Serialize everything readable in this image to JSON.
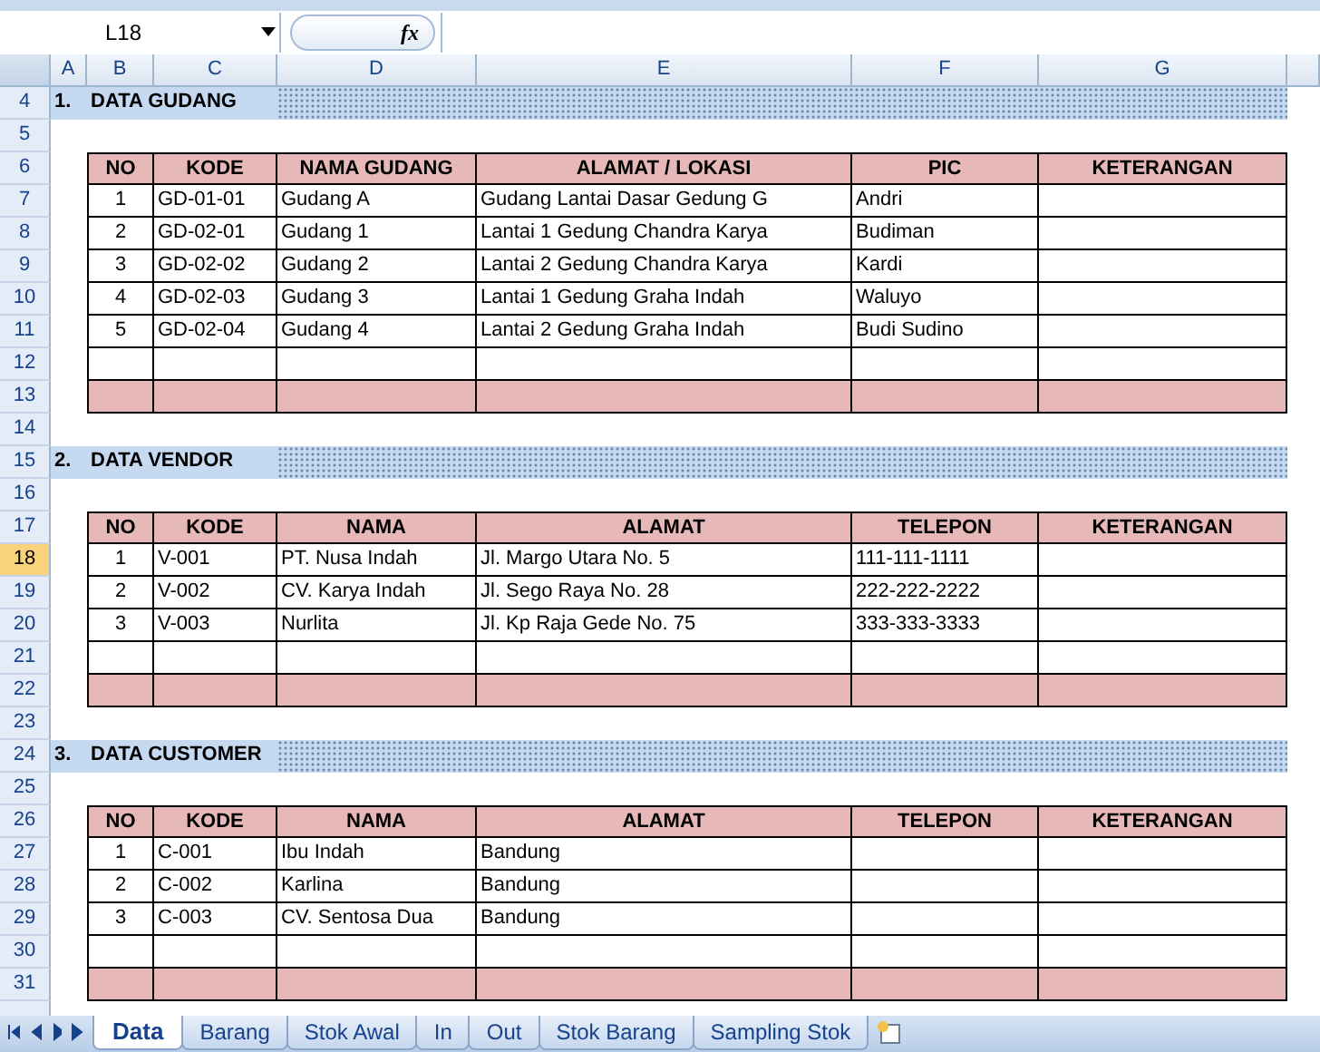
{
  "formula_bar": {
    "name_box": "L18",
    "function_label": "fx"
  },
  "column_headers": [
    "A",
    "B",
    "C",
    "D",
    "E",
    "F",
    "G"
  ],
  "row_headers": [
    {
      "label": "4",
      "selected": false
    },
    {
      "label": "5",
      "selected": false
    },
    {
      "label": "6",
      "selected": false
    },
    {
      "label": "7",
      "selected": false
    },
    {
      "label": "8",
      "selected": false
    },
    {
      "label": "9",
      "selected": false
    },
    {
      "label": "10",
      "selected": false
    },
    {
      "label": "11",
      "selected": false
    },
    {
      "label": "12",
      "selected": false
    },
    {
      "label": "13",
      "selected": false
    },
    {
      "label": "14",
      "selected": false
    },
    {
      "label": "15",
      "selected": false
    },
    {
      "label": "16",
      "selected": false
    },
    {
      "label": "17",
      "selected": false
    },
    {
      "label": "18",
      "selected": true
    },
    {
      "label": "19",
      "selected": false
    },
    {
      "label": "20",
      "selected": false
    },
    {
      "label": "21",
      "selected": false
    },
    {
      "label": "22",
      "selected": false
    },
    {
      "label": "23",
      "selected": false
    },
    {
      "label": "24",
      "selected": false
    },
    {
      "label": "25",
      "selected": false
    },
    {
      "label": "26",
      "selected": false
    },
    {
      "label": "27",
      "selected": false
    },
    {
      "label": "28",
      "selected": false
    },
    {
      "label": "29",
      "selected": false
    },
    {
      "label": "30",
      "selected": false
    },
    {
      "label": "31",
      "selected": false
    }
  ],
  "sections": [
    {
      "number": "1.",
      "title": "DATA GUDANG",
      "columns": [
        "NO",
        "KODE",
        "NAMA GUDANG",
        "ALAMAT / LOKASI",
        "PIC",
        "KETERANGAN"
      ],
      "rows": [
        {
          "kind": "data",
          "cells": [
            "1",
            "GD-01-01",
            "Gudang A",
            "Gudang Lantai Dasar Gedung G",
            "Andri",
            ""
          ]
        },
        {
          "kind": "data",
          "cells": [
            "2",
            "GD-02-01",
            "Gudang 1",
            "Lantai 1 Gedung Chandra Karya",
            "Budiman",
            ""
          ]
        },
        {
          "kind": "data",
          "cells": [
            "3",
            "GD-02-02",
            "Gudang 2",
            "Lantai 2 Gedung Chandra Karya",
            "Kardi",
            ""
          ]
        },
        {
          "kind": "data",
          "cells": [
            "4",
            "GD-02-03",
            "Gudang 3",
            "Lantai 1 Gedung Graha Indah",
            "Waluyo",
            ""
          ]
        },
        {
          "kind": "data",
          "cells": [
            "5",
            "GD-02-04",
            "Gudang 4",
            "Lantai 2 Gedung Graha Indah",
            "Budi Sudino",
            ""
          ]
        },
        {
          "kind": "blank"
        },
        {
          "kind": "footer"
        }
      ]
    },
    {
      "number": "2.",
      "title": "DATA VENDOR",
      "columns": [
        "NO",
        "KODE",
        "NAMA",
        "ALAMAT",
        "TELEPON",
        "KETERANGAN"
      ],
      "rows": [
        {
          "kind": "data",
          "cells": [
            "1",
            "V-001",
            "PT. Nusa Indah",
            "Jl. Margo Utara No. 5",
            "111-111-1111",
            ""
          ]
        },
        {
          "kind": "data",
          "cells": [
            "2",
            "V-002",
            "CV. Karya Indah",
            "Jl. Sego Raya No. 28",
            "222-222-2222",
            ""
          ]
        },
        {
          "kind": "data",
          "cells": [
            "3",
            "V-003",
            "Nurlita",
            "Jl. Kp Raja Gede No. 75",
            "333-333-3333",
            ""
          ]
        },
        {
          "kind": "blank"
        },
        {
          "kind": "footer"
        }
      ]
    },
    {
      "number": "3.",
      "title": "DATA CUSTOMER",
      "columns": [
        "NO",
        "KODE",
        "NAMA",
        "ALAMAT",
        "TELEPON",
        "KETERANGAN"
      ],
      "rows": [
        {
          "kind": "data",
          "cells": [
            "1",
            "C-001",
            "Ibu Indah",
            "Bandung",
            "",
            ""
          ]
        },
        {
          "kind": "data",
          "cells": [
            "2",
            "C-002",
            "Karlina",
            "Bandung",
            "",
            ""
          ]
        },
        {
          "kind": "data",
          "cells": [
            "3",
            "C-003",
            "CV. Sentosa Dua",
            "Bandung",
            "",
            ""
          ]
        },
        {
          "kind": "blank"
        },
        {
          "kind": "footer"
        }
      ]
    }
  ],
  "sheet_tabs": [
    {
      "label": "Data",
      "selected": true
    },
    {
      "label": "Barang",
      "selected": false
    },
    {
      "label": "Stok Awal",
      "selected": false
    },
    {
      "label": "In",
      "selected": false
    },
    {
      "label": "Out",
      "selected": false
    },
    {
      "label": "Stok Barang",
      "selected": false
    },
    {
      "label": "Sampling Stok",
      "selected": false
    }
  ]
}
